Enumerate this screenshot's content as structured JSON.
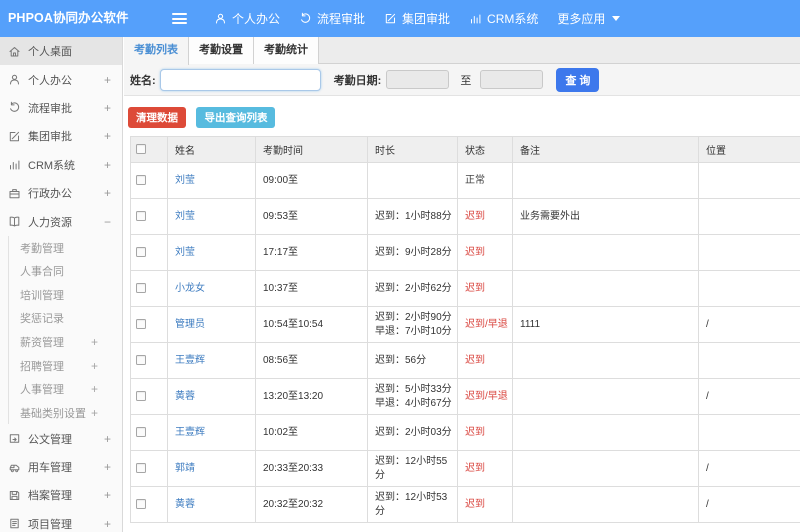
{
  "colors": {
    "navbar": "#55a0fb",
    "link": "#3e7cc0",
    "late": "#d9443e",
    "tab-active": "#4a8fd4",
    "danger": "#dd4a38",
    "info": "#57bbdf",
    "search": "#3d78ec"
  },
  "navbar": {
    "logo": "PHPOA协同办公软件",
    "menu_icon": "hamburger-icon",
    "items": [
      {
        "label": "个人办公",
        "icon": "user-icon"
      },
      {
        "label": "流程审批",
        "icon": "undo-icon"
      },
      {
        "label": "集团审批",
        "icon": "edit-icon"
      },
      {
        "label": "CRM系统",
        "icon": "chart-icon"
      },
      {
        "label": "更多应用",
        "icon": "caret-down-icon",
        "caret": true
      }
    ]
  },
  "sidebar": {
    "items": [
      {
        "label": "个人桌面",
        "icon": "home-icon",
        "expand": "",
        "active": true
      },
      {
        "label": "个人办公",
        "icon": "user-icon",
        "expand": "+"
      },
      {
        "label": "流程审批",
        "icon": "undo-icon",
        "expand": "+"
      },
      {
        "label": "集团审批",
        "icon": "edit-icon",
        "expand": "+"
      },
      {
        "label": "CRM系统",
        "icon": "chart-icon",
        "expand": "+"
      },
      {
        "label": "行政办公",
        "icon": "briefcase-icon",
        "expand": "+"
      },
      {
        "label": "人力资源",
        "icon": "book-icon",
        "expand": "−",
        "expanded": true,
        "children": [
          {
            "label": "考勤管理",
            "expand": ""
          },
          {
            "label": "人事合同",
            "expand": ""
          },
          {
            "label": "培训管理",
            "expand": ""
          },
          {
            "label": "奖惩记录",
            "expand": ""
          },
          {
            "label": "薪资管理",
            "expand": "+"
          },
          {
            "label": "招聘管理",
            "expand": "+"
          },
          {
            "label": "人事管理",
            "expand": "+"
          },
          {
            "label": "基础类别设置",
            "expand": "+"
          }
        ]
      },
      {
        "label": "公文管理",
        "icon": "document-icon",
        "expand": "+"
      },
      {
        "label": "用车管理",
        "icon": "car-icon",
        "expand": "+"
      },
      {
        "label": "档案管理",
        "icon": "archive-icon",
        "expand": "+"
      },
      {
        "label": "项目管理",
        "icon": "clipboard-icon",
        "expand": "+"
      }
    ]
  },
  "tabs": [
    {
      "label": "考勤列表",
      "active": true
    },
    {
      "label": "考勤设置",
      "active": false
    },
    {
      "label": "考勤统计",
      "active": false
    }
  ],
  "filter": {
    "name_label": "姓名:",
    "name_value": "",
    "date_label": "考勤日期:",
    "date_from": "",
    "to_label": "至",
    "date_to": "",
    "search_label": "查 询"
  },
  "actions": [
    {
      "label": "清理数据",
      "style": "danger"
    },
    {
      "label": "导出查询列表",
      "style": "info"
    }
  ],
  "table": {
    "columns": [
      "姓名",
      "考勤时间",
      "时长",
      "状态",
      "备注",
      "位置"
    ],
    "rows": [
      {
        "name": "刘莹",
        "time": "09:00至",
        "duration": "",
        "status": "正常",
        "status_type": "normal",
        "note": "",
        "location": ""
      },
      {
        "name": "刘莹",
        "time": "09:53至",
        "duration": "迟到：1小时88分",
        "status": "迟到",
        "status_type": "late",
        "note": "业务需要外出",
        "location": ""
      },
      {
        "name": "刘莹",
        "time": "17:17至",
        "duration": "迟到：9小时28分",
        "status": "迟到",
        "status_type": "late",
        "note": "",
        "location": ""
      },
      {
        "name": "小龙女",
        "time": "10:37至",
        "duration": "迟到：2小时62分",
        "status": "迟到",
        "status_type": "late",
        "note": "",
        "location": ""
      },
      {
        "name": "管理员",
        "time": "10:54至10:54",
        "duration": "迟到：2小时90分\n早退：7小时10分",
        "status": "迟到/早退",
        "status_type": "late",
        "note": "1111",
        "location": "/"
      },
      {
        "name": "王壹辉",
        "time": "08:56至",
        "duration": "迟到：56分",
        "status": "迟到",
        "status_type": "late",
        "note": "",
        "location": ""
      },
      {
        "name": "黄蓉",
        "time": "13:20至13:20",
        "duration": "迟到：5小时33分\n早退：4小时67分",
        "status": "迟到/早退",
        "status_type": "late",
        "note": "",
        "location": "/"
      },
      {
        "name": "王壹辉",
        "time": "10:02至",
        "duration": "迟到：2小时03分",
        "status": "迟到",
        "status_type": "late",
        "note": "",
        "location": ""
      },
      {
        "name": "郭靖",
        "time": "20:33至20:33",
        "duration": "迟到：12小时55分",
        "status": "迟到",
        "status_type": "late",
        "note": "",
        "location": "/"
      },
      {
        "name": "黄蓉",
        "time": "20:32至20:32",
        "duration": "迟到：12小时53分",
        "status": "迟到",
        "status_type": "late",
        "note": "",
        "location": "/"
      }
    ]
  }
}
